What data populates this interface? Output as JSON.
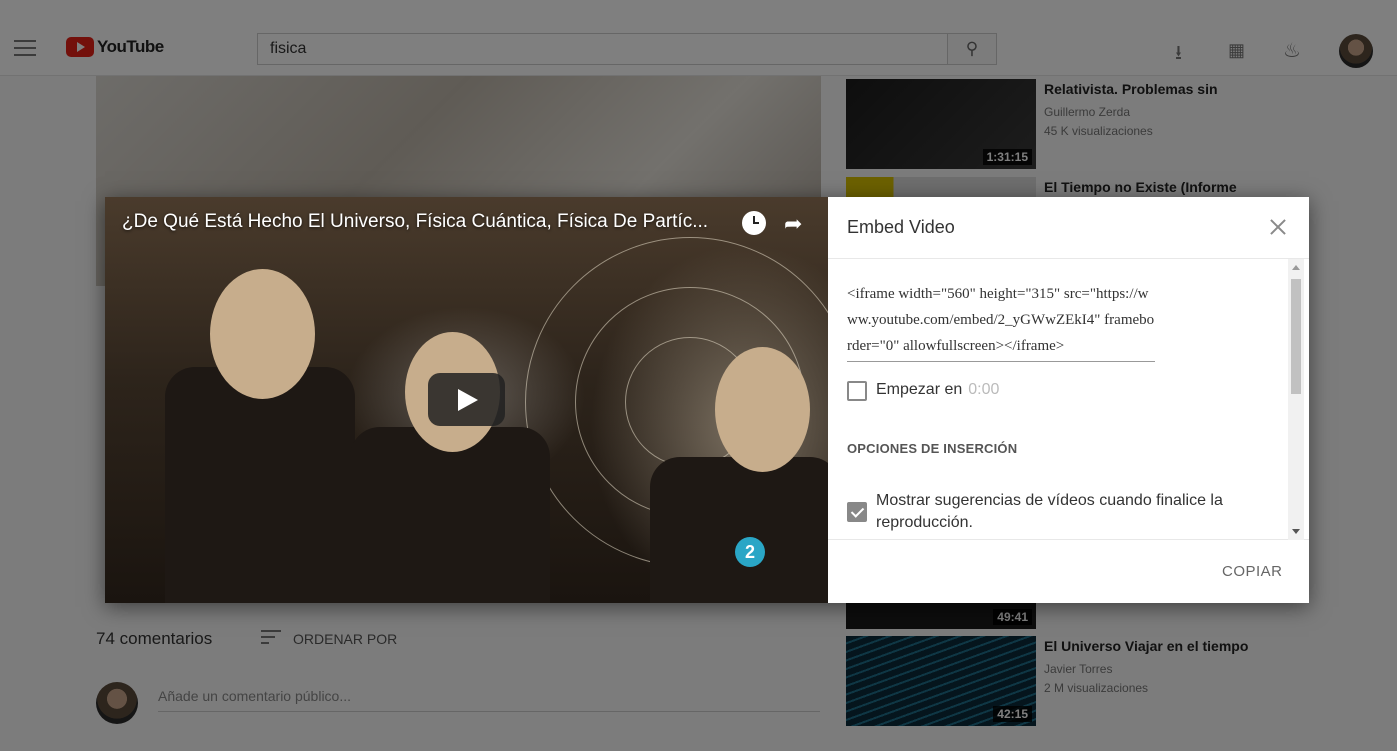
{
  "masthead": {
    "logo_text": "YouTube",
    "search_value": "fisica"
  },
  "page": {
    "comments_count": "74 comentarios",
    "sort_label": "ORDENAR POR",
    "comment_placeholder": "Añade un comentario público..."
  },
  "related": [
    {
      "title": "Relativista. Problemas sin",
      "channel": "Guillermo Zerda",
      "views": "45 K visualizaciones",
      "duration": "1:31:15"
    },
    {
      "title": "El Tiempo no Existe (Informe",
      "channel": "",
      "views": "",
      "duration": ""
    },
    {
      "title": "",
      "channel": "",
      "views": "",
      "duration": "49:41"
    },
    {
      "title": "El Universo Viajar en el tiempo",
      "channel": "Javier Torres",
      "views": "2 M visualizaciones",
      "duration": "42:15"
    }
  ],
  "embed_modal": {
    "video_title": "¿De Qué Está Hecho El Universo, Física Cuántica, Física De Partíc...",
    "panel_title": "Embed Video",
    "embed_code": "<iframe width=\"560\" height=\"315\" src=\"https://www.youtube.com/embed/2_yGWwZEkI4\" frameborder=\"0\" allowfullscreen></iframe>",
    "start_at_label": "Empezar en",
    "start_at_value": "0:00",
    "start_at_checked": false,
    "section_heading": "OPCIONES DE INSERCIÓN",
    "suggestions_label": "Mostrar sugerencias de vídeos cuando finalice la reproducción.",
    "suggestions_checked": true,
    "copy_label": "COPIAR",
    "badge_text": "2"
  }
}
